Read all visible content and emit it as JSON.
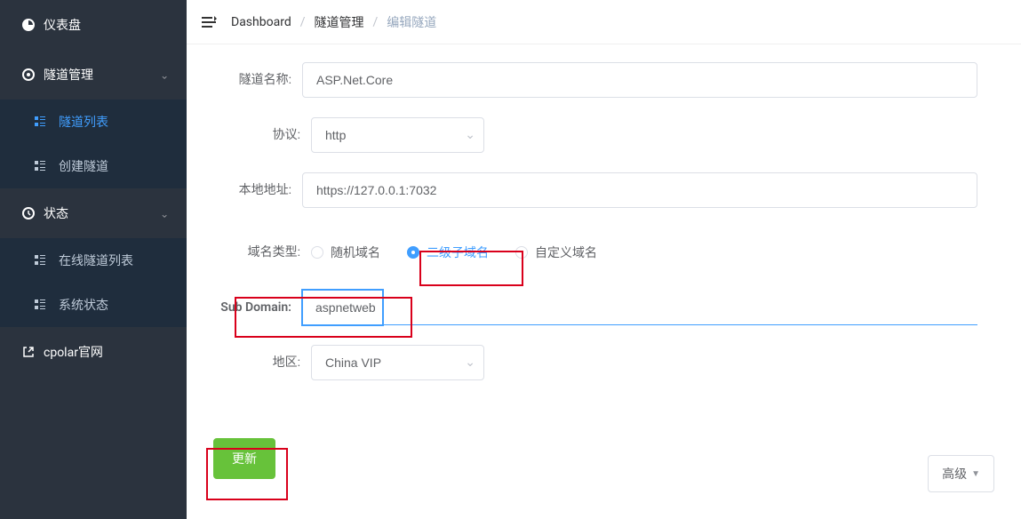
{
  "sidebar": {
    "dashboard": "仪表盘",
    "tunnel_management": "隧道管理",
    "tunnel_list": "隧道列表",
    "create_tunnel": "创建隧道",
    "status": "状态",
    "online_tunnel_list": "在线隧道列表",
    "system_status": "系统状态",
    "cpolar_site": "cpolar官网"
  },
  "breadcrumb": {
    "dashboard": "Dashboard",
    "tunnel_management": "隧道管理",
    "edit_tunnel": "编辑隧道"
  },
  "form": {
    "tunnel_name_label": "隧道名称:",
    "tunnel_name_value": "ASP.Net.Core",
    "protocol_label": "协议:",
    "protocol_value": "http",
    "local_address_label": "本地地址:",
    "local_address_value": "https://127.0.0.1:7032",
    "domain_type_label": "域名类型:",
    "domain_type_options": {
      "random": "随机域名",
      "subdomain": "二级子域名",
      "custom": "自定义域名"
    },
    "domain_type_selected": "subdomain",
    "subdomain_label": "Sub Domain:",
    "subdomain_value": "aspnetweb",
    "region_label": "地区:",
    "region_value": "China VIP",
    "advanced_label": "高级",
    "update_label": "更新"
  }
}
